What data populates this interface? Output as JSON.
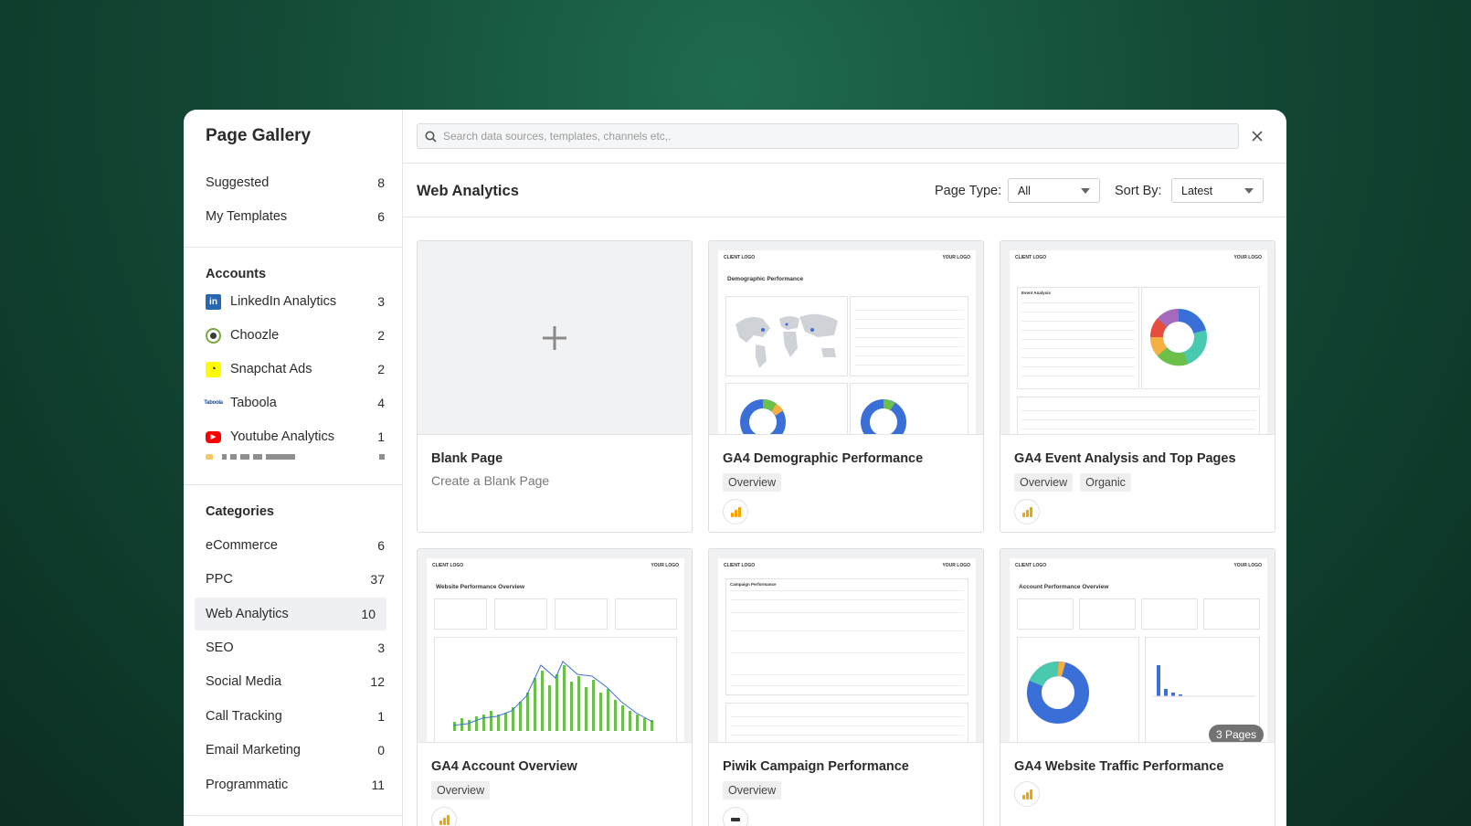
{
  "sidebar": {
    "title": "Page Gallery",
    "top_items": [
      {
        "label": "Suggested",
        "count": "8"
      },
      {
        "label": "My Templates",
        "count": "6"
      }
    ],
    "accounts_heading": "Accounts",
    "accounts": [
      {
        "label": "LinkedIn Analytics",
        "count": "3",
        "icon": "linkedin-icon",
        "color": "#2867b2"
      },
      {
        "label": "Choozle",
        "count": "2",
        "icon": "choozle-icon",
        "color": "#7aa843"
      },
      {
        "label": "Snapchat Ads",
        "count": "2",
        "icon": "snapchat-icon",
        "color": "#fffc00"
      },
      {
        "label": "Taboola",
        "count": "4",
        "icon": "taboola-icon",
        "color": "#1a4fa0"
      },
      {
        "label": "Youtube Analytics",
        "count": "1",
        "icon": "youtube-icon",
        "color": "#ff0000"
      }
    ],
    "categories_heading": "Categories",
    "categories": [
      {
        "label": "eCommerce",
        "count": "6"
      },
      {
        "label": "PPC",
        "count": "37"
      },
      {
        "label": "Web Analytics",
        "count": "10",
        "active": true
      },
      {
        "label": "SEO",
        "count": "3"
      },
      {
        "label": "Social Media",
        "count": "12"
      },
      {
        "label": "Call Tracking",
        "count": "1"
      },
      {
        "label": "Email Marketing",
        "count": "0"
      },
      {
        "label": "Programmatic",
        "count": "11"
      }
    ]
  },
  "search": {
    "placeholder": "Search data sources, templates, channels etc,."
  },
  "header": {
    "title": "Web Analytics",
    "page_type_label": "Page Type:",
    "page_type_value": "All",
    "sort_label": "Sort By:",
    "sort_value": "Latest"
  },
  "cards": [
    {
      "title": "Blank Page",
      "subtitle": "Create a Blank Page"
    },
    {
      "title": "GA4 Demographic Performance",
      "tags": [
        "Overview"
      ]
    },
    {
      "title": "GA4 Event Analysis and Top Pages",
      "tags": [
        "Overview",
        "Organic"
      ]
    },
    {
      "title": "GA4 Account Overview",
      "tags": [
        "Overview"
      ]
    },
    {
      "title": "Piwik Campaign Performance",
      "tags": [
        "Overview"
      ]
    },
    {
      "title": "GA4 Website Traffic Performance",
      "tags": [],
      "badge": "3 Pages"
    }
  ],
  "mini": {
    "client_logo": "CLIENT LOGO",
    "your_logo": "YOUR LOGO",
    "demo_title": "Demographic Performance",
    "event_title": "Event Analysis",
    "account_title": "Website Performance Overview",
    "piwik_title": "Campaign Performance",
    "traffic_title": "Account Performance Overview"
  },
  "colors": {
    "accent": "#2b2b2b",
    "ga": "#f4a300",
    "donut_blue": "#3b6fd8"
  }
}
